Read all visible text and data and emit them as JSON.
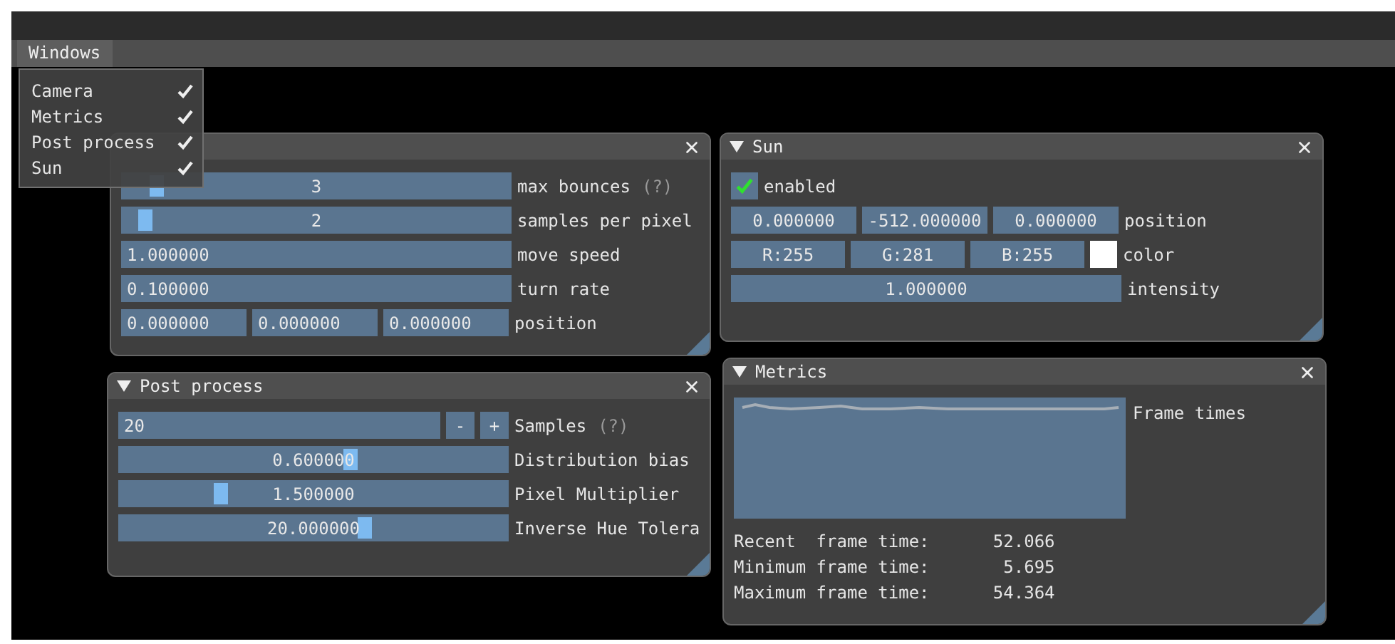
{
  "menu_bar": {
    "items": [
      {
        "label": "Windows",
        "selected": true
      }
    ]
  },
  "windows_menu": {
    "items": [
      {
        "label": "Camera",
        "checked": true
      },
      {
        "label": "Metrics",
        "checked": true
      },
      {
        "label": "Post process",
        "checked": true
      },
      {
        "label": "Sun",
        "checked": true
      }
    ]
  },
  "camera": {
    "rows": [
      {
        "kind": "slider",
        "value": "3",
        "level": 0.07,
        "label": "max bounces",
        "help": "(?)"
      },
      {
        "kind": "slider",
        "value": "2",
        "level": 0.04,
        "label": "samples per pixel"
      },
      {
        "kind": "input",
        "value": "1.000000",
        "label": "move speed"
      },
      {
        "kind": "input",
        "value": "0.100000",
        "label": "turn rate"
      },
      {
        "kind": "inputs",
        "values": [
          "0.000000",
          "0.000000",
          "0.000000"
        ],
        "label": "position"
      }
    ]
  },
  "sun": {
    "title": "Sun",
    "expanded": true,
    "rows": [
      {
        "kind": "checkbox",
        "checked": true,
        "label": "enabled"
      },
      {
        "kind": "drags",
        "values": [
          "0.000000",
          "-512.000000",
          "0.000000"
        ],
        "label": "position"
      },
      {
        "kind": "color",
        "values": [
          "R:255",
          "G:281",
          "B:255"
        ],
        "color": "#ffffff",
        "label": "color"
      },
      {
        "kind": "drag",
        "value": "1.000000",
        "label": "intensity"
      }
    ]
  },
  "post_process": {
    "title": "Post process",
    "expanded": true,
    "rows": [
      {
        "kind": "stepper",
        "value": "20",
        "minus": "-",
        "plus": "+",
        "label": "Samples",
        "help": "(?)"
      },
      {
        "kind": "slider",
        "value": "0.600000",
        "level": 0.6,
        "label": "Distribution bias"
      },
      {
        "kind": "slider",
        "value": "1.500000",
        "level": 0.25,
        "label": "Pixel Multiplier"
      },
      {
        "kind": "slider",
        "value": "20.000000",
        "level": 0.64,
        "label": "Inverse Hue Tolera"
      }
    ]
  },
  "metrics": {
    "title": "Metrics",
    "expanded": true,
    "plot_label": "Frame times",
    "stats": [
      {
        "label": "Recent  frame time:",
        "value": "52.066"
      },
      {
        "label": "Minimum frame time:",
        "value": "5.695"
      },
      {
        "label": "Maximum frame time:",
        "value": "54.364"
      }
    ]
  }
}
